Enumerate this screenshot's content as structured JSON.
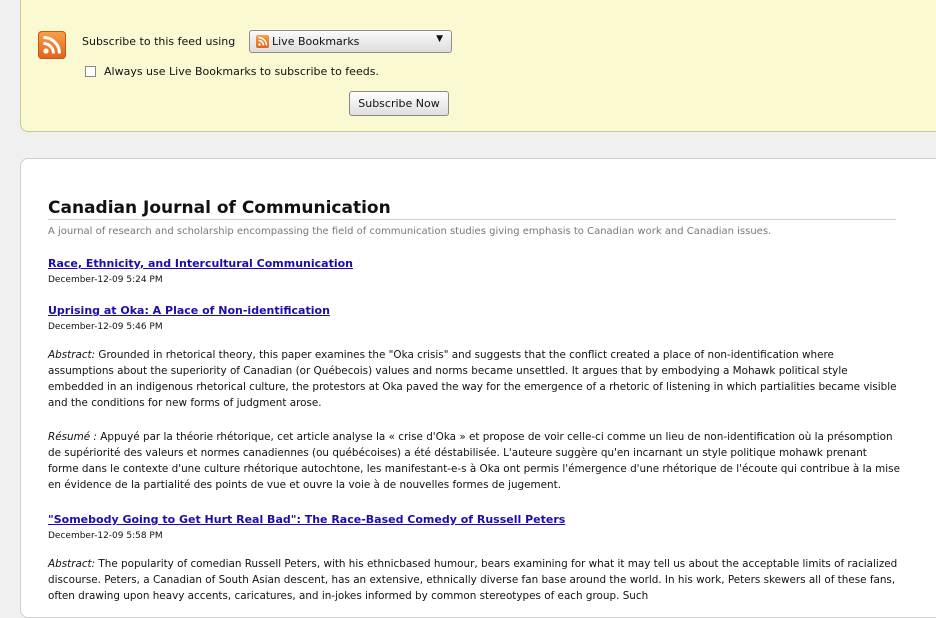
{
  "subscribe": {
    "label": "Subscribe to this feed using",
    "reader_selected": "Live Bookmarks",
    "always_label": "Always use Live Bookmarks to subscribe to feeds.",
    "always_checked": false,
    "button_label": "Subscribe Now"
  },
  "feed": {
    "title": "Canadian Journal of Communication",
    "subtitle": "A journal of research and scholarship encompassing the field of communication studies giving emphasis to Canadian work and Canadian issues.",
    "entries": [
      {
        "title": "Race, Ethnicity, and Intercultural Communication",
        "date": "December-12-09 5:24 PM"
      },
      {
        "title": "Uprising at Oka: A Place of Non-identification",
        "date": "December-12-09 5:46 PM",
        "abstract_label": "Abstract:",
        "abstract_text": " Grounded in rhetorical theory, this paper examines the \"Oka crisis\" and suggests that the conflict created a place of non-identification where assumptions about the superiority of Canadian (or Québecois) values and norms became unsettled. It argues that by embodying a Mohawk political style embedded in an indigenous rhetorical culture, the protestors at Oka paved the way for the emergence of a rhetoric of listening in which partialities became visible and the conditions for new forms of judgment arose.",
        "resume_label": "Résumé :",
        "resume_text": " Appuyé par la théorie rhétorique, cet article analyse la « crise d'Oka » et propose de voir celle-ci comme un lieu de non-identification où la présomption de supériorité des valeurs et normes canadiennes (ou québécoises) a été déstabilisée. L'auteure suggère qu'en incarnant un style politique mohawk prenant forme dans le contexte d'une culture rhétorique autochtone, les manifestant-e-s à Oka ont permis l'émergence d'une rhétorique de l'écoute qui contribue à la mise en évidence de la partialité des points de vue et ouvre la voie à de nouvelles formes de jugement."
      },
      {
        "title": "\"Somebody Going to Get Hurt Real Bad\": The Race-Based Comedy of Russell Peters",
        "date": "December-12-09 5:58 PM",
        "abstract_label": "Abstract:",
        "abstract_text": " The popularity of comedian Russell Peters, with his ethnicbased humour, bears examining for what it may tell us about the acceptable limits of racialized discourse. Peters, a Canadian of South Asian descent, has an extensive, ethnically diverse fan base around the world. In his work, Peters skewers all of these fans, often drawing upon heavy accents, caricatures, and in-jokes informed by common stereotypes of each group. Such"
      }
    ]
  }
}
